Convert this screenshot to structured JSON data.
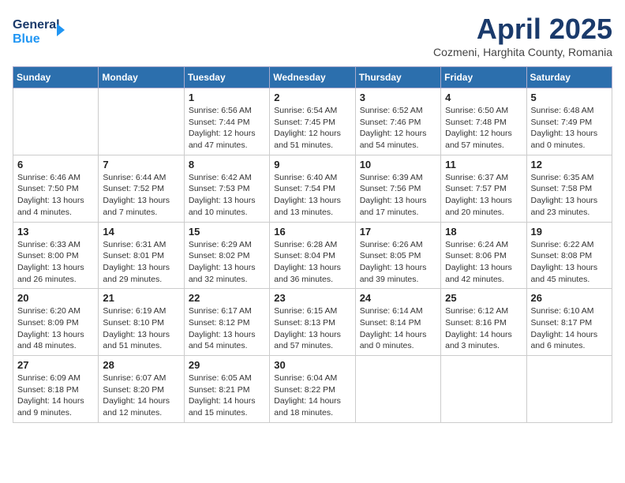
{
  "header": {
    "logo_line1": "General",
    "logo_line2": "Blue",
    "month_title": "April 2025",
    "location": "Cozmeni, Harghita County, Romania"
  },
  "days_of_week": [
    "Sunday",
    "Monday",
    "Tuesday",
    "Wednesday",
    "Thursday",
    "Friday",
    "Saturday"
  ],
  "weeks": [
    [
      {
        "day": "",
        "info": ""
      },
      {
        "day": "",
        "info": ""
      },
      {
        "day": "1",
        "info": "Sunrise: 6:56 AM\nSunset: 7:44 PM\nDaylight: 12 hours and 47 minutes."
      },
      {
        "day": "2",
        "info": "Sunrise: 6:54 AM\nSunset: 7:45 PM\nDaylight: 12 hours and 51 minutes."
      },
      {
        "day": "3",
        "info": "Sunrise: 6:52 AM\nSunset: 7:46 PM\nDaylight: 12 hours and 54 minutes."
      },
      {
        "day": "4",
        "info": "Sunrise: 6:50 AM\nSunset: 7:48 PM\nDaylight: 12 hours and 57 minutes."
      },
      {
        "day": "5",
        "info": "Sunrise: 6:48 AM\nSunset: 7:49 PM\nDaylight: 13 hours and 0 minutes."
      }
    ],
    [
      {
        "day": "6",
        "info": "Sunrise: 6:46 AM\nSunset: 7:50 PM\nDaylight: 13 hours and 4 minutes."
      },
      {
        "day": "7",
        "info": "Sunrise: 6:44 AM\nSunset: 7:52 PM\nDaylight: 13 hours and 7 minutes."
      },
      {
        "day": "8",
        "info": "Sunrise: 6:42 AM\nSunset: 7:53 PM\nDaylight: 13 hours and 10 minutes."
      },
      {
        "day": "9",
        "info": "Sunrise: 6:40 AM\nSunset: 7:54 PM\nDaylight: 13 hours and 13 minutes."
      },
      {
        "day": "10",
        "info": "Sunrise: 6:39 AM\nSunset: 7:56 PM\nDaylight: 13 hours and 17 minutes."
      },
      {
        "day": "11",
        "info": "Sunrise: 6:37 AM\nSunset: 7:57 PM\nDaylight: 13 hours and 20 minutes."
      },
      {
        "day": "12",
        "info": "Sunrise: 6:35 AM\nSunset: 7:58 PM\nDaylight: 13 hours and 23 minutes."
      }
    ],
    [
      {
        "day": "13",
        "info": "Sunrise: 6:33 AM\nSunset: 8:00 PM\nDaylight: 13 hours and 26 minutes."
      },
      {
        "day": "14",
        "info": "Sunrise: 6:31 AM\nSunset: 8:01 PM\nDaylight: 13 hours and 29 minutes."
      },
      {
        "day": "15",
        "info": "Sunrise: 6:29 AM\nSunset: 8:02 PM\nDaylight: 13 hours and 32 minutes."
      },
      {
        "day": "16",
        "info": "Sunrise: 6:28 AM\nSunset: 8:04 PM\nDaylight: 13 hours and 36 minutes."
      },
      {
        "day": "17",
        "info": "Sunrise: 6:26 AM\nSunset: 8:05 PM\nDaylight: 13 hours and 39 minutes."
      },
      {
        "day": "18",
        "info": "Sunrise: 6:24 AM\nSunset: 8:06 PM\nDaylight: 13 hours and 42 minutes."
      },
      {
        "day": "19",
        "info": "Sunrise: 6:22 AM\nSunset: 8:08 PM\nDaylight: 13 hours and 45 minutes."
      }
    ],
    [
      {
        "day": "20",
        "info": "Sunrise: 6:20 AM\nSunset: 8:09 PM\nDaylight: 13 hours and 48 minutes."
      },
      {
        "day": "21",
        "info": "Sunrise: 6:19 AM\nSunset: 8:10 PM\nDaylight: 13 hours and 51 minutes."
      },
      {
        "day": "22",
        "info": "Sunrise: 6:17 AM\nSunset: 8:12 PM\nDaylight: 13 hours and 54 minutes."
      },
      {
        "day": "23",
        "info": "Sunrise: 6:15 AM\nSunset: 8:13 PM\nDaylight: 13 hours and 57 minutes."
      },
      {
        "day": "24",
        "info": "Sunrise: 6:14 AM\nSunset: 8:14 PM\nDaylight: 14 hours and 0 minutes."
      },
      {
        "day": "25",
        "info": "Sunrise: 6:12 AM\nSunset: 8:16 PM\nDaylight: 14 hours and 3 minutes."
      },
      {
        "day": "26",
        "info": "Sunrise: 6:10 AM\nSunset: 8:17 PM\nDaylight: 14 hours and 6 minutes."
      }
    ],
    [
      {
        "day": "27",
        "info": "Sunrise: 6:09 AM\nSunset: 8:18 PM\nDaylight: 14 hours and 9 minutes."
      },
      {
        "day": "28",
        "info": "Sunrise: 6:07 AM\nSunset: 8:20 PM\nDaylight: 14 hours and 12 minutes."
      },
      {
        "day": "29",
        "info": "Sunrise: 6:05 AM\nSunset: 8:21 PM\nDaylight: 14 hours and 15 minutes."
      },
      {
        "day": "30",
        "info": "Sunrise: 6:04 AM\nSunset: 8:22 PM\nDaylight: 14 hours and 18 minutes."
      },
      {
        "day": "",
        "info": ""
      },
      {
        "day": "",
        "info": ""
      },
      {
        "day": "",
        "info": ""
      }
    ]
  ]
}
